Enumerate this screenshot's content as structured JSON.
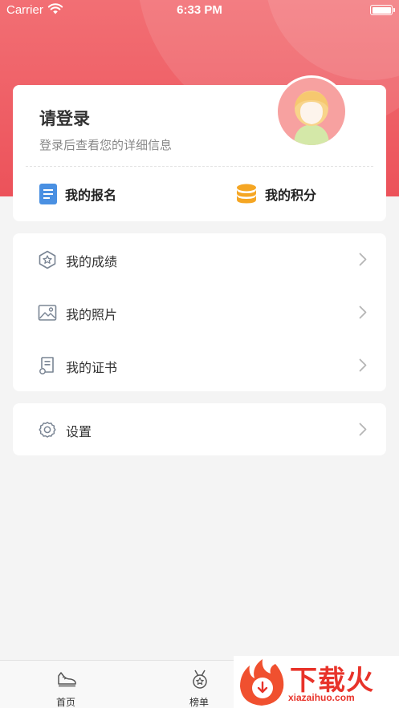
{
  "status_bar": {
    "carrier": "Carrier",
    "time": "6:33 PM"
  },
  "profile": {
    "login_title": "请登录",
    "login_subtitle": "登录后查看您的详细信息",
    "quick_links": [
      {
        "label": "我的报名",
        "icon": "document-icon",
        "color": "#4a90e2"
      },
      {
        "label": "我的积分",
        "icon": "coin-stack-icon",
        "color": "#f5a623"
      }
    ]
  },
  "menu": [
    {
      "label": "我的成绩",
      "icon": "hexagon-star-icon"
    },
    {
      "label": "我的照片",
      "icon": "photo-icon"
    },
    {
      "label": "我的证书",
      "icon": "certificate-icon"
    }
  ],
  "settings": {
    "label": "设置",
    "icon": "gear-icon"
  },
  "tabbar": [
    {
      "label": "首页",
      "icon": "sneaker-icon"
    },
    {
      "label": "榜单",
      "icon": "medal-icon"
    }
  ],
  "watermark": {
    "text": "下载火",
    "url": "xiazaihuo.com"
  },
  "colors": {
    "accent": "#ec525a",
    "background": "#f4f4f4"
  }
}
